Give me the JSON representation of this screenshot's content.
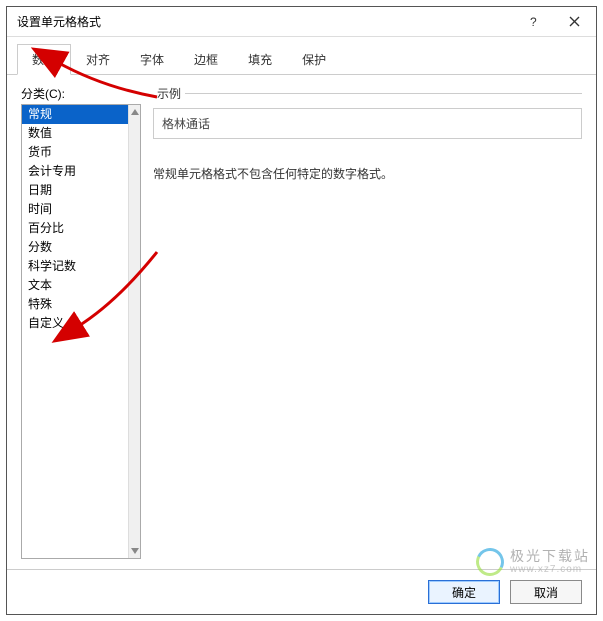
{
  "titlebar": {
    "title": "设置单元格格式"
  },
  "tabs": [
    {
      "label": "数字"
    },
    {
      "label": "对齐"
    },
    {
      "label": "字体"
    },
    {
      "label": "边框"
    },
    {
      "label": "填充"
    },
    {
      "label": "保护"
    }
  ],
  "category": {
    "label": "分类(C):",
    "items": [
      "常规",
      "数值",
      "货币",
      "会计专用",
      "日期",
      "时间",
      "百分比",
      "分数",
      "科学记数",
      "文本",
      "特殊",
      "自定义"
    ],
    "selected_index": 0
  },
  "sample": {
    "group_label": "示例",
    "value": "格林通话"
  },
  "description": "常规单元格格式不包含任何特定的数字格式。",
  "buttons": {
    "ok": "确定",
    "cancel": "取消"
  },
  "watermark": {
    "line1": "极光下载站",
    "line2": "www.xz7.com"
  }
}
